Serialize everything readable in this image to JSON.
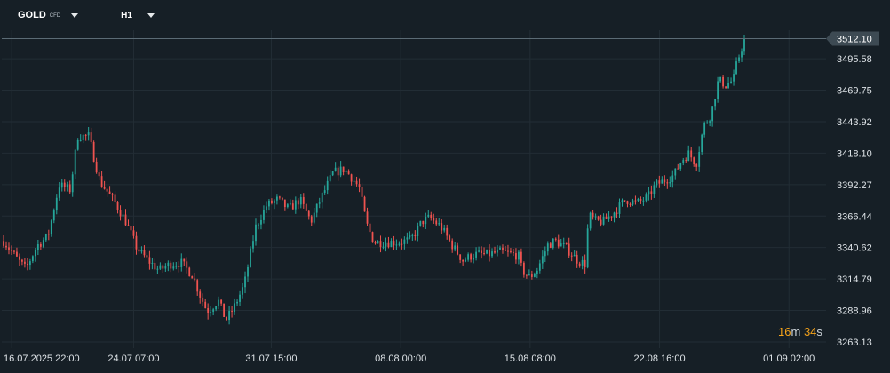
{
  "toolbar": {
    "symbol": "GOLD",
    "symbol_tag": "CFD",
    "timeframe": "H1"
  },
  "countdown": {
    "minutes": "16",
    "minutes_unit": "m",
    "seconds": "34",
    "seconds_unit": "s"
  },
  "colors": {
    "background": "#161f26",
    "grid": "#222d35",
    "up": "#26a69a",
    "down": "#ef5350",
    "price_line": "#5b6b75",
    "price_badge": "#3d4a53",
    "axis_text": "#dfe4e8"
  },
  "chart_data": {
    "type": "candlestick",
    "symbol": "GOLD CFD",
    "timeframe": "H1",
    "current_price": 3512.1,
    "current_price_label": "3512.10",
    "y_ticks": [
      "3495.58",
      "3469.75",
      "3443.92",
      "3418.10",
      "3392.27",
      "3366.44",
      "3340.62",
      "3314.79",
      "3288.96",
      "3263.13"
    ],
    "y_tick_values": [
      3495.58,
      3469.75,
      3443.92,
      3418.1,
      3392.27,
      3366.44,
      3340.62,
      3314.79,
      3288.96,
      3263.13
    ],
    "ylim": [
      3258,
      3519
    ],
    "x_ticks": [
      "16.07.2025  22:00",
      "24.07  07:00",
      "31.07  15:00",
      "08.08  00:00",
      "15.08  08:00",
      "22.08  16:00",
      "01.09  02:00"
    ],
    "x_tick_positions": [
      0.012,
      0.16,
      0.327,
      0.484,
      0.641,
      0.798,
      0.955
    ],
    "grid": true,
    "price_path": [
      [
        0.0,
        3346
      ],
      [
        0.02,
        3330
      ],
      [
        0.03,
        3323
      ],
      [
        0.045,
        3342
      ],
      [
        0.06,
        3350
      ],
      [
        0.075,
        3392
      ],
      [
        0.09,
        3388
      ],
      [
        0.1,
        3432
      ],
      [
        0.115,
        3432
      ],
      [
        0.13,
        3395
      ],
      [
        0.15,
        3378
      ],
      [
        0.165,
        3362
      ],
      [
        0.18,
        3340
      ],
      [
        0.195,
        3330
      ],
      [
        0.21,
        3322
      ],
      [
        0.225,
        3327
      ],
      [
        0.24,
        3328
      ],
      [
        0.255,
        3318
      ],
      [
        0.265,
        3302
      ],
      [
        0.275,
        3288
      ],
      [
        0.29,
        3297
      ],
      [
        0.3,
        3281
      ],
      [
        0.31,
        3290
      ],
      [
        0.325,
        3310
      ],
      [
        0.34,
        3357
      ],
      [
        0.355,
        3375
      ],
      [
        0.37,
        3380
      ],
      [
        0.385,
        3372
      ],
      [
        0.4,
        3380
      ],
      [
        0.415,
        3362
      ],
      [
        0.43,
        3383
      ],
      [
        0.445,
        3402
      ],
      [
        0.46,
        3405
      ],
      [
        0.47,
        3398
      ],
      [
        0.48,
        3390
      ],
      [
        0.49,
        3360
      ],
      [
        0.5,
        3345
      ],
      [
        0.52,
        3345
      ],
      [
        0.535,
        3345
      ],
      [
        0.55,
        3347
      ],
      [
        0.565,
        3362
      ],
      [
        0.575,
        3365
      ],
      [
        0.59,
        3358
      ],
      [
        0.605,
        3343
      ],
      [
        0.62,
        3330
      ],
      [
        0.635,
        3335
      ],
      [
        0.655,
        3335
      ],
      [
        0.67,
        3337
      ],
      [
        0.68,
        3336
      ],
      [
        0.695,
        3334
      ],
      [
        0.7,
        3322
      ],
      [
        0.71,
        3316
      ],
      [
        0.72,
        3322
      ],
      [
        0.735,
        3343
      ],
      [
        0.745,
        3346
      ],
      [
        0.76,
        3340
      ],
      [
        0.775,
        3330
      ],
      [
        0.785,
        3327
      ],
      [
        0.79,
        3367
      ],
      [
        0.8,
        3362
      ],
      [
        0.81,
        3362
      ],
      [
        0.825,
        3370
      ],
      [
        0.84,
        3380
      ],
      [
        0.855,
        3377
      ],
      [
        0.87,
        3382
      ],
      [
        0.88,
        3392
      ],
      [
        0.89,
        3395
      ],
      [
        0.905,
        3400
      ],
      [
        0.915,
        3412
      ],
      [
        0.925,
        3418
      ],
      [
        0.935,
        3409
      ],
      [
        0.945,
        3440
      ],
      [
        0.955,
        3450
      ],
      [
        0.965,
        3478
      ],
      [
        0.975,
        3474
      ],
      [
        0.985,
        3478
      ],
      [
        0.99,
        3492
      ],
      [
        1.0,
        3512
      ]
    ]
  }
}
